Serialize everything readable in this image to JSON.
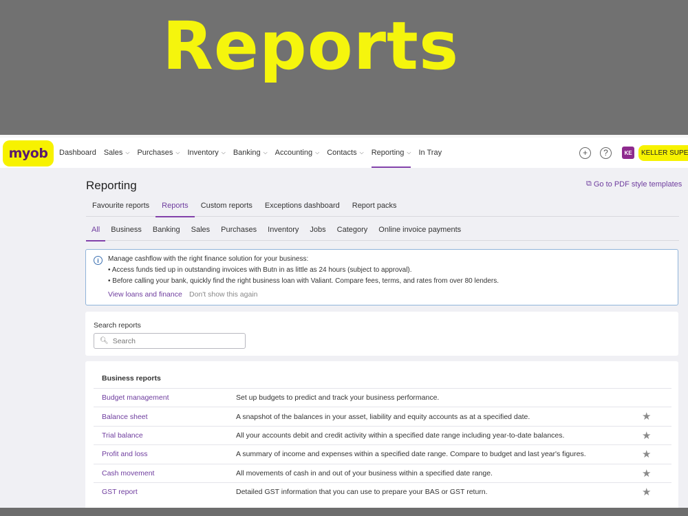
{
  "banner": {
    "title": "Reports",
    "title_color": "#f5f50d"
  },
  "logo": {
    "text": "myob",
    "highlight_color": "#f7f200"
  },
  "nav": {
    "items": [
      {
        "label": "Dashboard",
        "dropdown": false
      },
      {
        "label": "Sales",
        "dropdown": true
      },
      {
        "label": "Purchases",
        "dropdown": true
      },
      {
        "label": "Inventory",
        "dropdown": true
      },
      {
        "label": "Banking",
        "dropdown": true
      },
      {
        "label": "Accounting",
        "dropdown": true
      },
      {
        "label": "Contacts",
        "dropdown": true
      },
      {
        "label": "Reporting",
        "dropdown": true,
        "active": true
      },
      {
        "label": "In Tray",
        "dropdown": false
      }
    ],
    "add_icon": "plus-circle-icon",
    "help_icon": "question-circle-icon",
    "user_initials": "KE",
    "company_name": "KELLER SUPERA"
  },
  "page": {
    "title": "Reporting",
    "pdf_link": "Go to PDF style templates",
    "accent_color": "#6e3c9e"
  },
  "tabs": [
    {
      "label": "Favourite reports"
    },
    {
      "label": "Reports",
      "active": true
    },
    {
      "label": "Custom reports"
    },
    {
      "label": "Exceptions dashboard"
    },
    {
      "label": "Report packs"
    }
  ],
  "subtabs": [
    {
      "label": "All",
      "active": true
    },
    {
      "label": "Business"
    },
    {
      "label": "Banking"
    },
    {
      "label": "Sales"
    },
    {
      "label": "Purchases"
    },
    {
      "label": "Inventory"
    },
    {
      "label": "Jobs"
    },
    {
      "label": "Category"
    },
    {
      "label": "Online invoice payments"
    }
  ],
  "info": {
    "line1": "Manage cashflow with the right finance solution for your business:",
    "line2": "• Access funds tied up in outstanding invoices with Butn in as little as 24 hours (subject to approval).",
    "line3": "• Before calling your bank, quickly find the right business loan with Valiant. Compare fees, terms, and rates from over 80 lenders.",
    "link_primary": "View loans and finance",
    "link_secondary": "Don't show this again"
  },
  "search": {
    "label": "Search reports",
    "placeholder": "Search"
  },
  "business_reports": {
    "title": "Business reports",
    "rows": [
      {
        "name": "Budget management",
        "desc": "Set up budgets to predict and track your business performance.",
        "star": false
      },
      {
        "name": "Balance sheet",
        "desc": "A snapshot of the balances in your asset, liability and equity accounts as at a specified date.",
        "star": true
      },
      {
        "name": "Trial balance",
        "desc": "All your accounts debit and credit activity within a specified date range including year-to-date balances.",
        "star": true
      },
      {
        "name": "Profit and loss",
        "desc": "A summary of income and expenses within a specified date range. Compare to budget and last year's figures.",
        "star": true
      },
      {
        "name": "Cash movement",
        "desc": "All movements of cash in and out of your business within a specified date range.",
        "star": true
      },
      {
        "name": "GST report",
        "desc": "Detailed GST information that you can use to prepare your BAS or GST return.",
        "star": true
      }
    ]
  }
}
